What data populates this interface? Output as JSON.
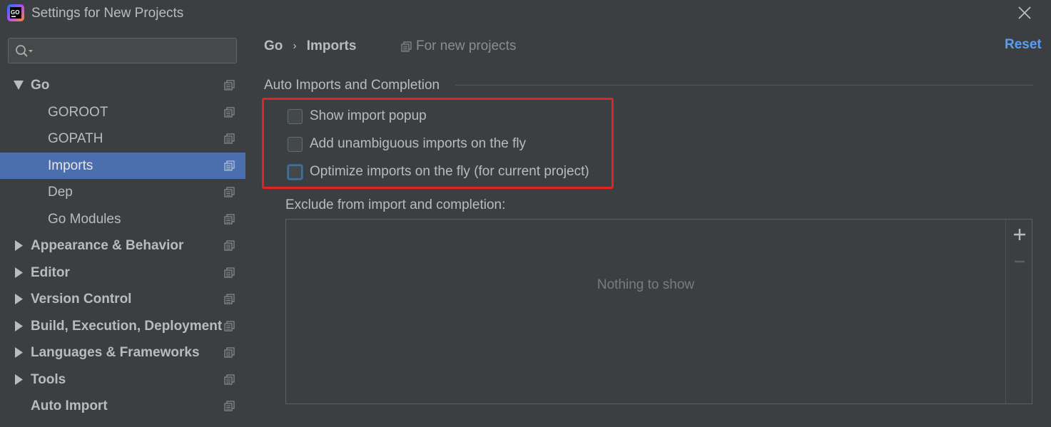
{
  "window": {
    "title": "Settings for New Projects",
    "app_icon_text": "GO"
  },
  "search": {
    "value": "",
    "placeholder": ""
  },
  "sidebar": {
    "items": [
      {
        "label": "Go",
        "expanded": true
      },
      {
        "label": "GOROOT"
      },
      {
        "label": "GOPATH"
      },
      {
        "label": "Imports",
        "selected": true
      },
      {
        "label": "Dep"
      },
      {
        "label": "Go Modules"
      },
      {
        "label": "Appearance & Behavior",
        "expanded": false
      },
      {
        "label": "Editor",
        "expanded": false
      },
      {
        "label": "Version Control",
        "expanded": false
      },
      {
        "label": "Build, Execution, Deployment",
        "expanded": false
      },
      {
        "label": "Languages & Frameworks",
        "expanded": false
      },
      {
        "label": "Tools",
        "expanded": false
      },
      {
        "label": "Auto Import"
      }
    ]
  },
  "header": {
    "breadcrumb": [
      "Go",
      "Imports"
    ],
    "breadcrumb_separator": "›",
    "scope_note": "For new projects",
    "reset_label": "Reset"
  },
  "auto_imports": {
    "section_title": "Auto Imports and Completion",
    "options": [
      {
        "label": "Show import popup",
        "checked": false
      },
      {
        "label": "Add unambiguous imports on the fly",
        "checked": false
      },
      {
        "label": "Optimize imports on the fly (for current project)",
        "checked": false,
        "focused": true
      }
    ]
  },
  "exclude": {
    "label": "Exclude from import and completion:",
    "empty_text": "Nothing to show",
    "add_icon": "plus-icon",
    "remove_icon": "minus-icon"
  },
  "colors": {
    "background": "#3c3f41",
    "selection": "#4b6eaf",
    "link": "#589df6",
    "highlight_border": "#e02424"
  }
}
